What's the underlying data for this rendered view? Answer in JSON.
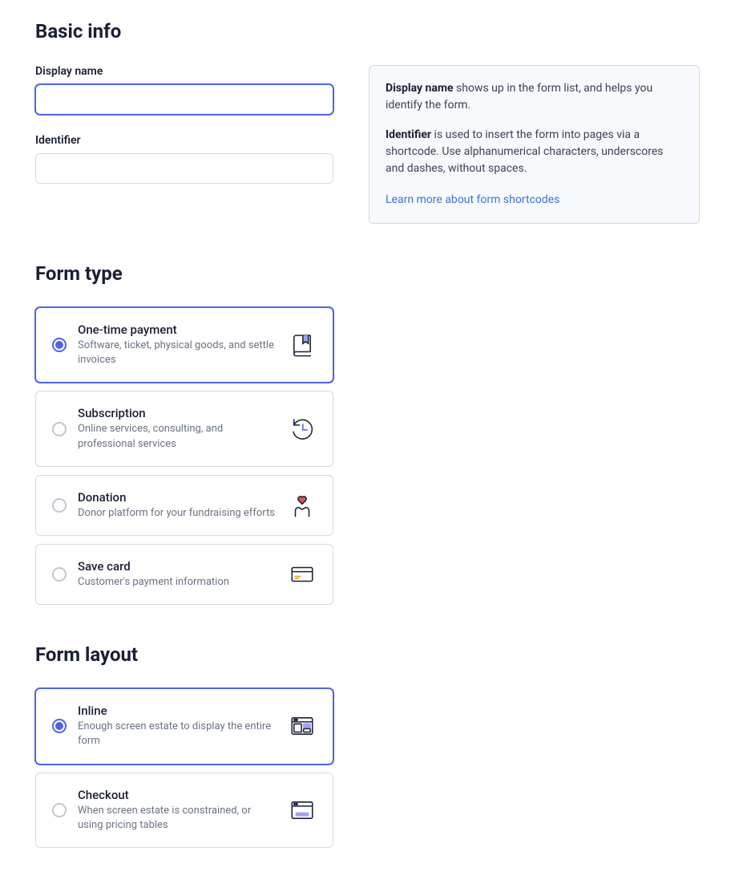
{
  "basic_info": {
    "heading": "Basic info",
    "display_name": {
      "label": "Display name",
      "value": ""
    },
    "identifier": {
      "label": "Identifier",
      "value": ""
    },
    "help": {
      "display_name_bold": "Display name",
      "display_name_text": " shows up in the form list, and helps you identify the form.",
      "identifier_bold": "Identifier",
      "identifier_text": " is used to insert the form into pages via a shortcode. Use alphanumerical characters, underscores and dashes, without spaces.",
      "link_text": "Learn more about form shortcodes"
    }
  },
  "form_type": {
    "heading": "Form type",
    "options": [
      {
        "title": "One-time payment",
        "desc": "Software, ticket, physical goods, and settle invoices",
        "selected": true
      },
      {
        "title": "Subscription",
        "desc": "Online services, consulting, and professional services",
        "selected": false
      },
      {
        "title": "Donation",
        "desc": "Donor platform for your fundraising efforts",
        "selected": false
      },
      {
        "title": "Save card",
        "desc": "Customer's payment information",
        "selected": false
      }
    ]
  },
  "form_layout": {
    "heading": "Form layout",
    "options": [
      {
        "title": "Inline",
        "desc": "Enough screen estate to display the entire form",
        "selected": true
      },
      {
        "title": "Checkout",
        "desc": "When screen estate is constrained, or using pricing tables",
        "selected": false
      }
    ]
  }
}
